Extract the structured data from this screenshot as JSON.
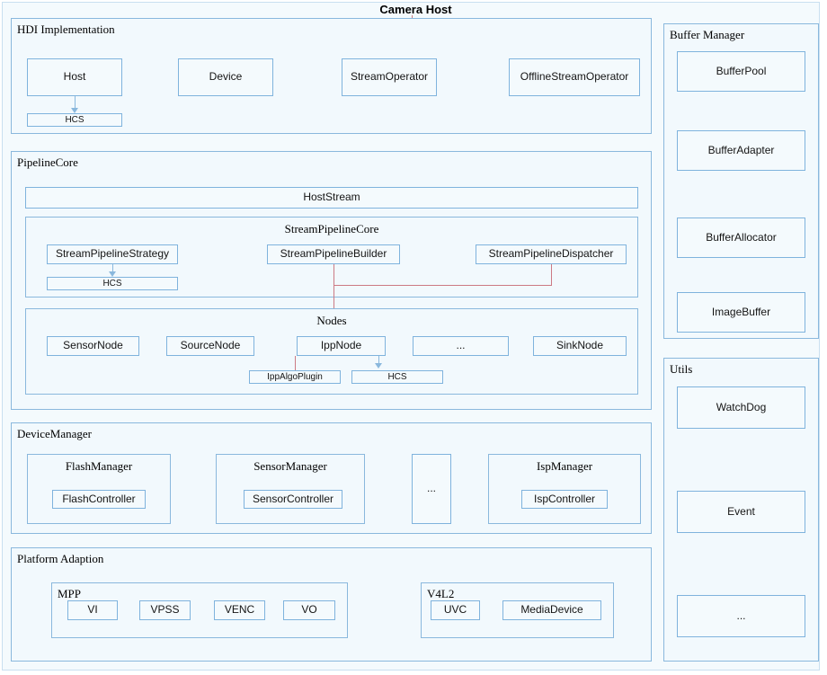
{
  "diagram": {
    "title": "Camera Host",
    "sections": {
      "hdi": {
        "title": "HDI Implementation",
        "boxes": [
          {
            "label": "Host"
          },
          {
            "label": "Device"
          },
          {
            "label": "StreamOperator"
          },
          {
            "label": "OfflineStreamOperator"
          }
        ],
        "host_hcs": "HCS"
      },
      "pipeline_core": {
        "title": "PipelineCore",
        "host_stream": "HostStream",
        "stream_pipeline_core": {
          "title": "StreamPipelineCore",
          "boxes": [
            {
              "label": "StreamPipelineStrategy"
            },
            {
              "label": "StreamPipelineBuilder"
            },
            {
              "label": "StreamPipelineDispatcher"
            }
          ],
          "strategy_hcs": "HCS"
        },
        "nodes": {
          "title": "Nodes",
          "boxes": [
            {
              "label": "SensorNode"
            },
            {
              "label": "SourceNode"
            },
            {
              "label": "IppNode"
            },
            {
              "label": "..."
            },
            {
              "label": "SinkNode"
            }
          ],
          "ipp_algo_plugin": "IppAlgoPlugin",
          "ipp_hcs": "HCS"
        }
      },
      "device_manager": {
        "title": "DeviceManager",
        "managers": [
          {
            "title": "FlashManager",
            "controller": "FlashController"
          },
          {
            "title": "SensorManager",
            "controller": "SensorController"
          },
          {
            "title": "...",
            "controller": null
          },
          {
            "title": "IspManager",
            "controller": "IspController"
          }
        ]
      },
      "platform_adaption": {
        "title": "Platform Adaption",
        "mpp": {
          "title": "MPP",
          "boxes": [
            {
              "label": "VI"
            },
            {
              "label": "VPSS"
            },
            {
              "label": "VENC"
            },
            {
              "label": "VO"
            }
          ]
        },
        "v4l2": {
          "title": "V4L2",
          "boxes": [
            {
              "label": "UVC"
            },
            {
              "label": "MediaDevice"
            }
          ]
        }
      },
      "buffer_manager": {
        "title": "Buffer Manager",
        "boxes": [
          {
            "label": "BufferPool"
          },
          {
            "label": "BufferAdapter"
          },
          {
            "label": "BufferAllocator"
          },
          {
            "label": "ImageBuffer"
          }
        ]
      },
      "utils": {
        "title": "Utils",
        "boxes": [
          {
            "label": "WatchDog"
          },
          {
            "label": "Event"
          },
          {
            "label": "..."
          }
        ]
      }
    },
    "colors": {
      "box_border": "#7fb3dd",
      "panel_border": "#8ab8dd",
      "panel_fill": "#f2f9fd",
      "connector_red": "#cc7a84",
      "connector_blue": "#8ab8dd",
      "page_background": "#f4fafd"
    }
  }
}
